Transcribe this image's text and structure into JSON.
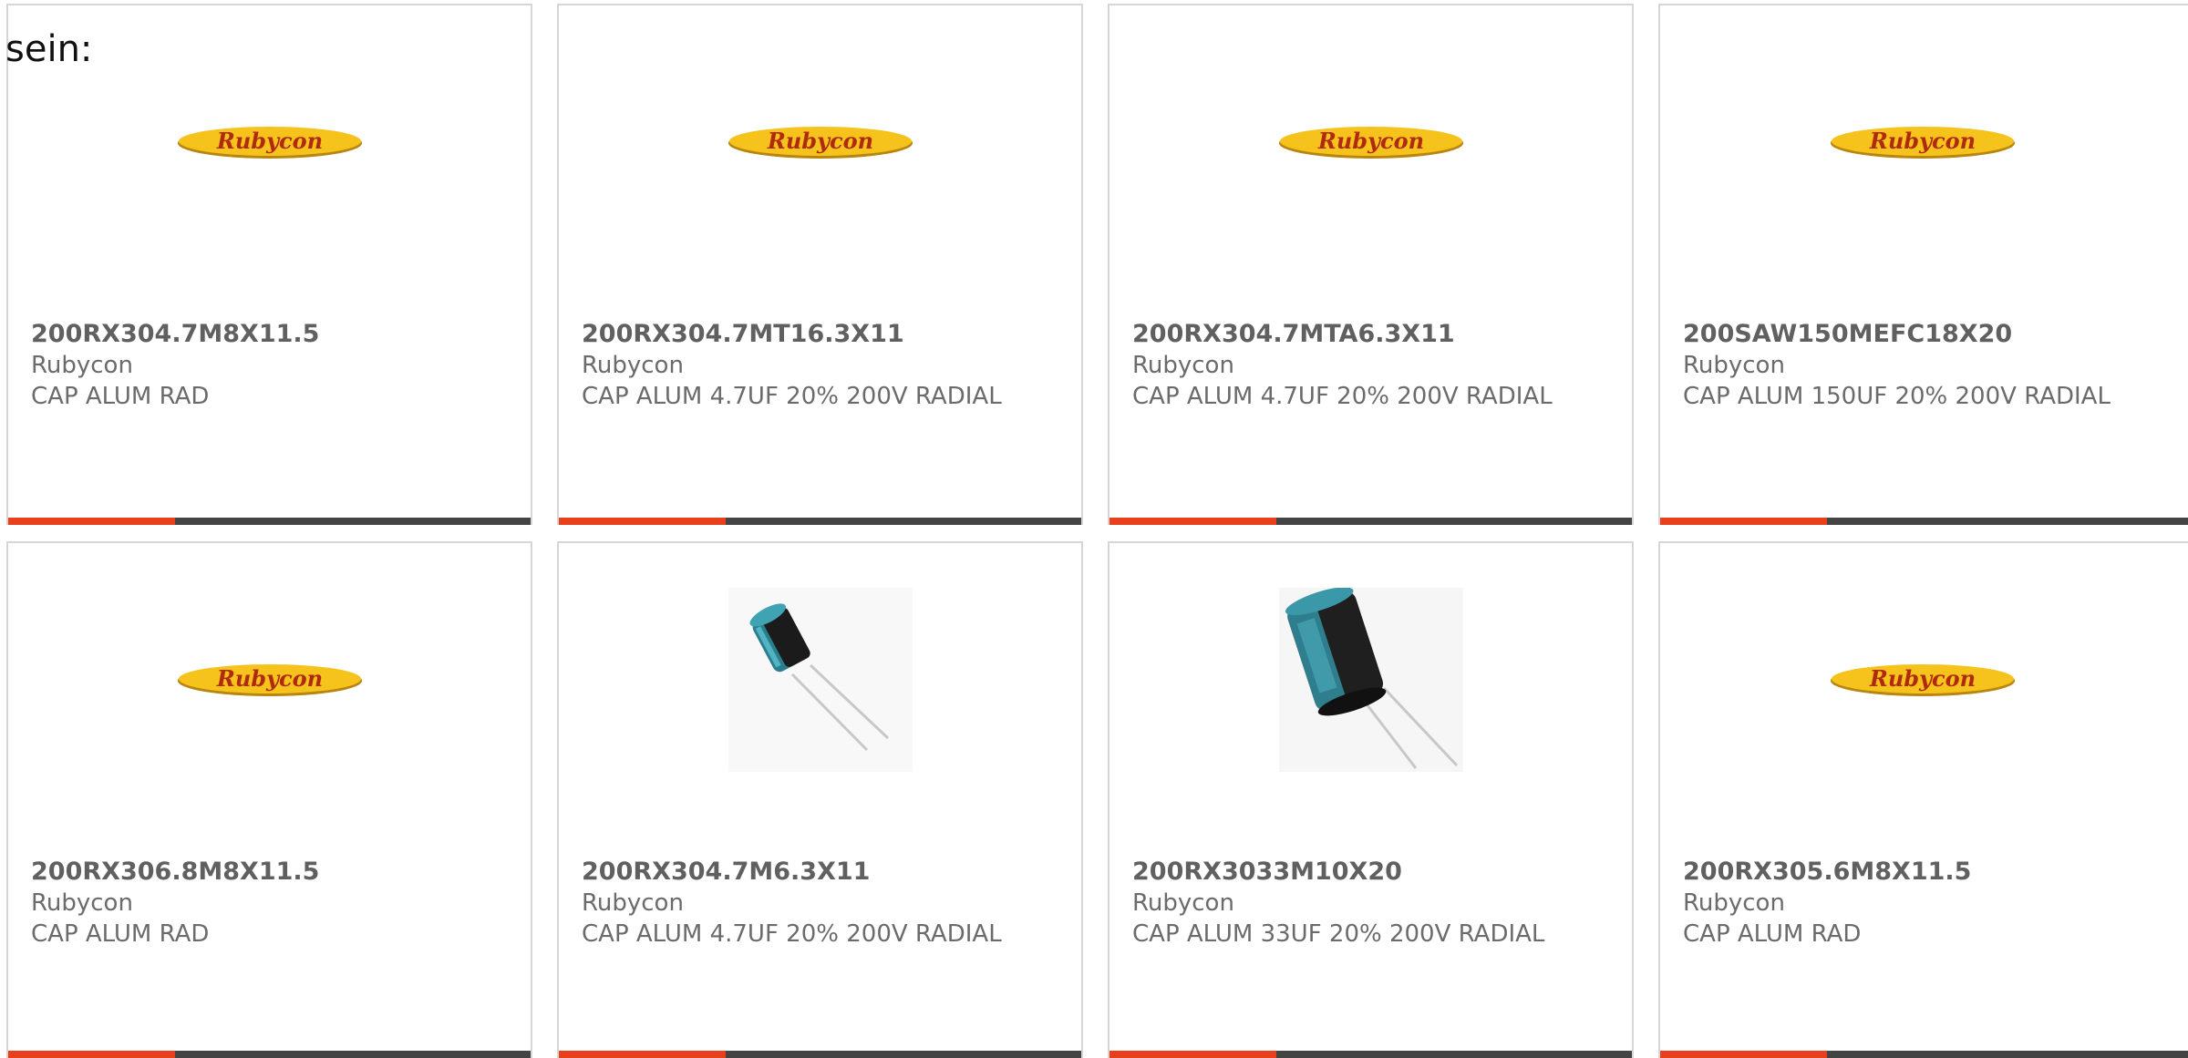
{
  "intro_text": "sein:",
  "colors": {
    "accent_bar": "#e8401c",
    "dark_bar": "#444444",
    "logo_yellow": "#f6c21c",
    "logo_text": "#b02a10"
  },
  "products": [
    {
      "part_number": "200RX304.7M8X11.5",
      "manufacturer": "Rubycon",
      "description": "CAP ALUM RAD",
      "image": "rubycon-logo",
      "logo_text": "Rubycon"
    },
    {
      "part_number": "200RX304.7MT16.3X11",
      "manufacturer": "Rubycon",
      "description": "CAP ALUM 4.7UF 20% 200V RADIAL",
      "image": "rubycon-logo",
      "logo_text": "Rubycon"
    },
    {
      "part_number": "200RX304.7MTA6.3X11",
      "manufacturer": "Rubycon",
      "description": "CAP ALUM 4.7UF 20% 200V RADIAL",
      "image": "rubycon-logo",
      "logo_text": "Rubycon"
    },
    {
      "part_number": "200SAW150MEFC18X20",
      "manufacturer": "Rubycon",
      "description": "CAP ALUM 150UF 20% 200V RADIAL",
      "image": "rubycon-logo",
      "logo_text": "Rubycon"
    },
    {
      "part_number": "200RX306.8M8X11.5",
      "manufacturer": "Rubycon",
      "description": "CAP ALUM RAD",
      "image": "rubycon-logo",
      "logo_text": "Rubycon"
    },
    {
      "part_number": "200RX304.7M6.3X11",
      "manufacturer": "Rubycon",
      "description": "CAP ALUM 4.7UF 20% 200V RADIAL",
      "image": "capacitor-photo-small"
    },
    {
      "part_number": "200RX3033M10X20",
      "manufacturer": "Rubycon",
      "description": "CAP ALUM 33UF 20% 200V RADIAL",
      "image": "capacitor-photo-large"
    },
    {
      "part_number": "200RX305.6M8X11.5",
      "manufacturer": "Rubycon",
      "description": "CAP ALUM RAD",
      "image": "rubycon-logo",
      "logo_text": "Rubycon"
    }
  ]
}
